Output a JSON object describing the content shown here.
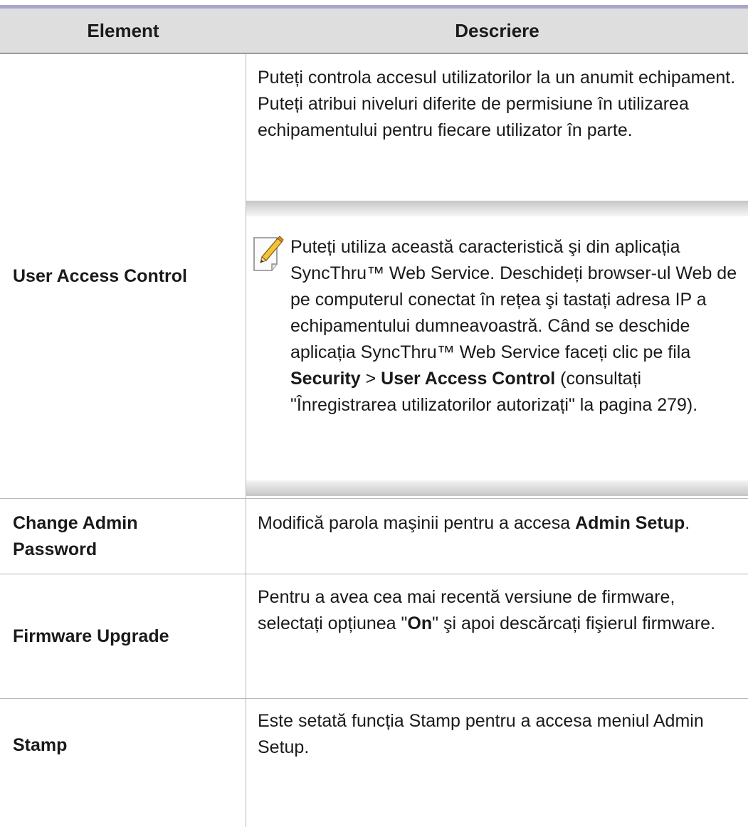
{
  "header": {
    "element": "Element",
    "description": "Descriere"
  },
  "rows": [
    {
      "element": "User Access Control",
      "description": "Puteți controla accesul utilizatorilor la un anumit echipament. Puteți atribui niveluri diferite de permisiune în utilizarea echipamentului pentru fiecare utilizator în parte.",
      "note": {
        "icon": "note-pencil-icon",
        "text_1": "Puteți utiliza această caracteristică şi din aplicația SyncThru™ Web Service. Deschideți browser-ul Web de pe computerul conectat în rețea şi tastați adresa IP a echipamentului dumneavoastră. Când se deschide aplicația SyncThru™ Web Service faceți clic pe fila ",
        "bold_1": "Security",
        "text_2": " > ",
        "bold_2": "User Access Control",
        "text_3": " (consultați \"Înregistrarea utilizatorilor autorizați\" la pagina 279)."
      }
    },
    {
      "element": "Change Admin Password",
      "desc_text": "Modifică parola maşinii pentru a accesa ",
      "desc_bold": "Admin Setup",
      "desc_end": "."
    },
    {
      "element": "Firmware Upgrade",
      "desc_text_1": "Pentru a avea cea mai recentă versiune de firmware, selectați opțiunea \"",
      "desc_bold": "On",
      "desc_text_2": "\" şi apoi descărcați fişierul firmware."
    },
    {
      "element": "Stamp",
      "description": "Este setată funcția Stamp pentru a accesa meniul Admin Setup."
    }
  ]
}
